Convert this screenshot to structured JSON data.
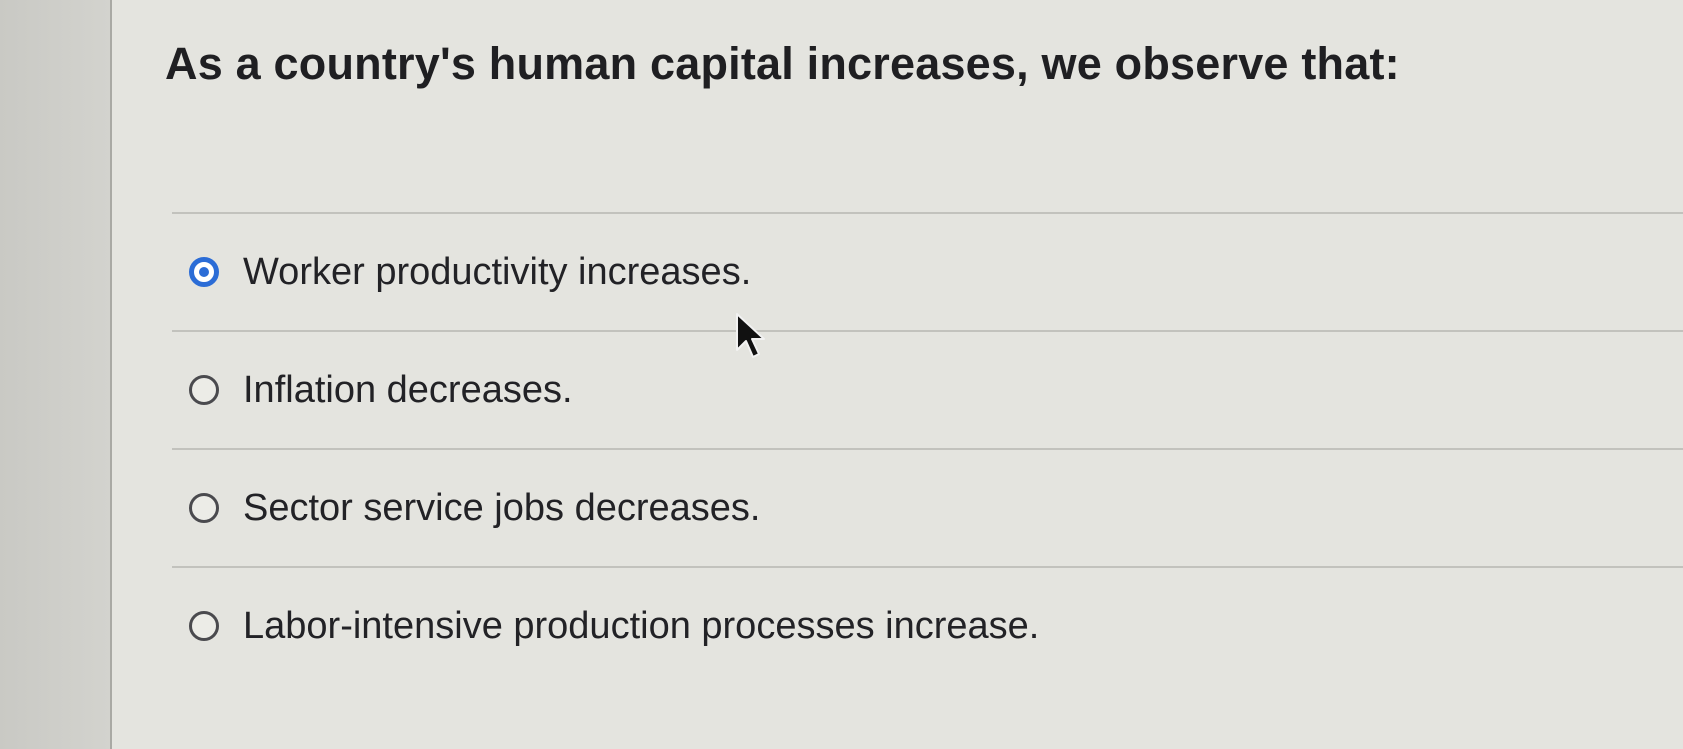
{
  "question": {
    "text": "As a country's human capital increases, we observe that:"
  },
  "options": [
    {
      "label": "Worker productivity increases.",
      "selected": true
    },
    {
      "label": "Inflation decreases.",
      "selected": false
    },
    {
      "label": "Sector service jobs decreases.",
      "selected": false
    },
    {
      "label": "Labor-intensive production processes increase.",
      "selected": false
    }
  ],
  "colors": {
    "accent": "#2b6cd6",
    "text": "#222226",
    "background": "#e4e4df"
  }
}
